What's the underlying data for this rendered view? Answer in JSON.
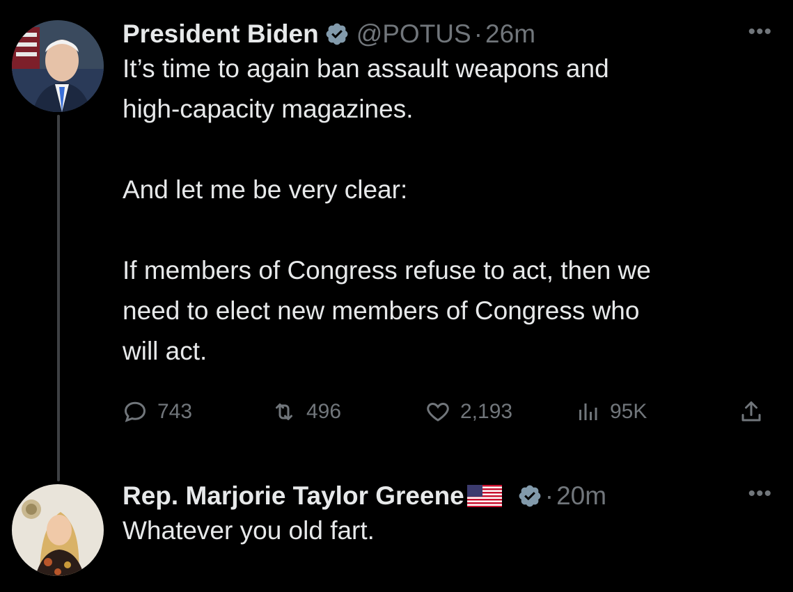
{
  "tweets": [
    {
      "author_name": "President Biden",
      "handle": "@POTUS",
      "separator": "·",
      "time": "26m",
      "more": "•••",
      "text": "It’s time to again ban assault weapons and\nhigh-capacity magazines.\n\nAnd let me be very clear:\n\nIf members of Congress refuse to act, then we\nneed to elect new members of Congress who\nwill act.",
      "stats": {
        "replies": "743",
        "retweets": "496",
        "likes": "2,193",
        "views": "95K"
      },
      "icons": {
        "verified": "verified-badge-icon",
        "reply": "reply-icon",
        "retweet": "retweet-icon",
        "like": "heart-icon",
        "views": "views-icon",
        "share": "share-icon"
      }
    },
    {
      "author_name": "Rep. Marjorie Taylor Greene",
      "separator": "·",
      "time": "20m",
      "more": "•••",
      "text": "Whatever you old fart.",
      "icons": {
        "flag": "us-flag-icon",
        "verified": "verified-badge-icon"
      }
    }
  ],
  "colors": {
    "background": "#000000",
    "primary_text": "#e7e9ea",
    "secondary_text": "#71767b",
    "thread_line": "#3e4144",
    "verified_badge": "#829aab"
  }
}
